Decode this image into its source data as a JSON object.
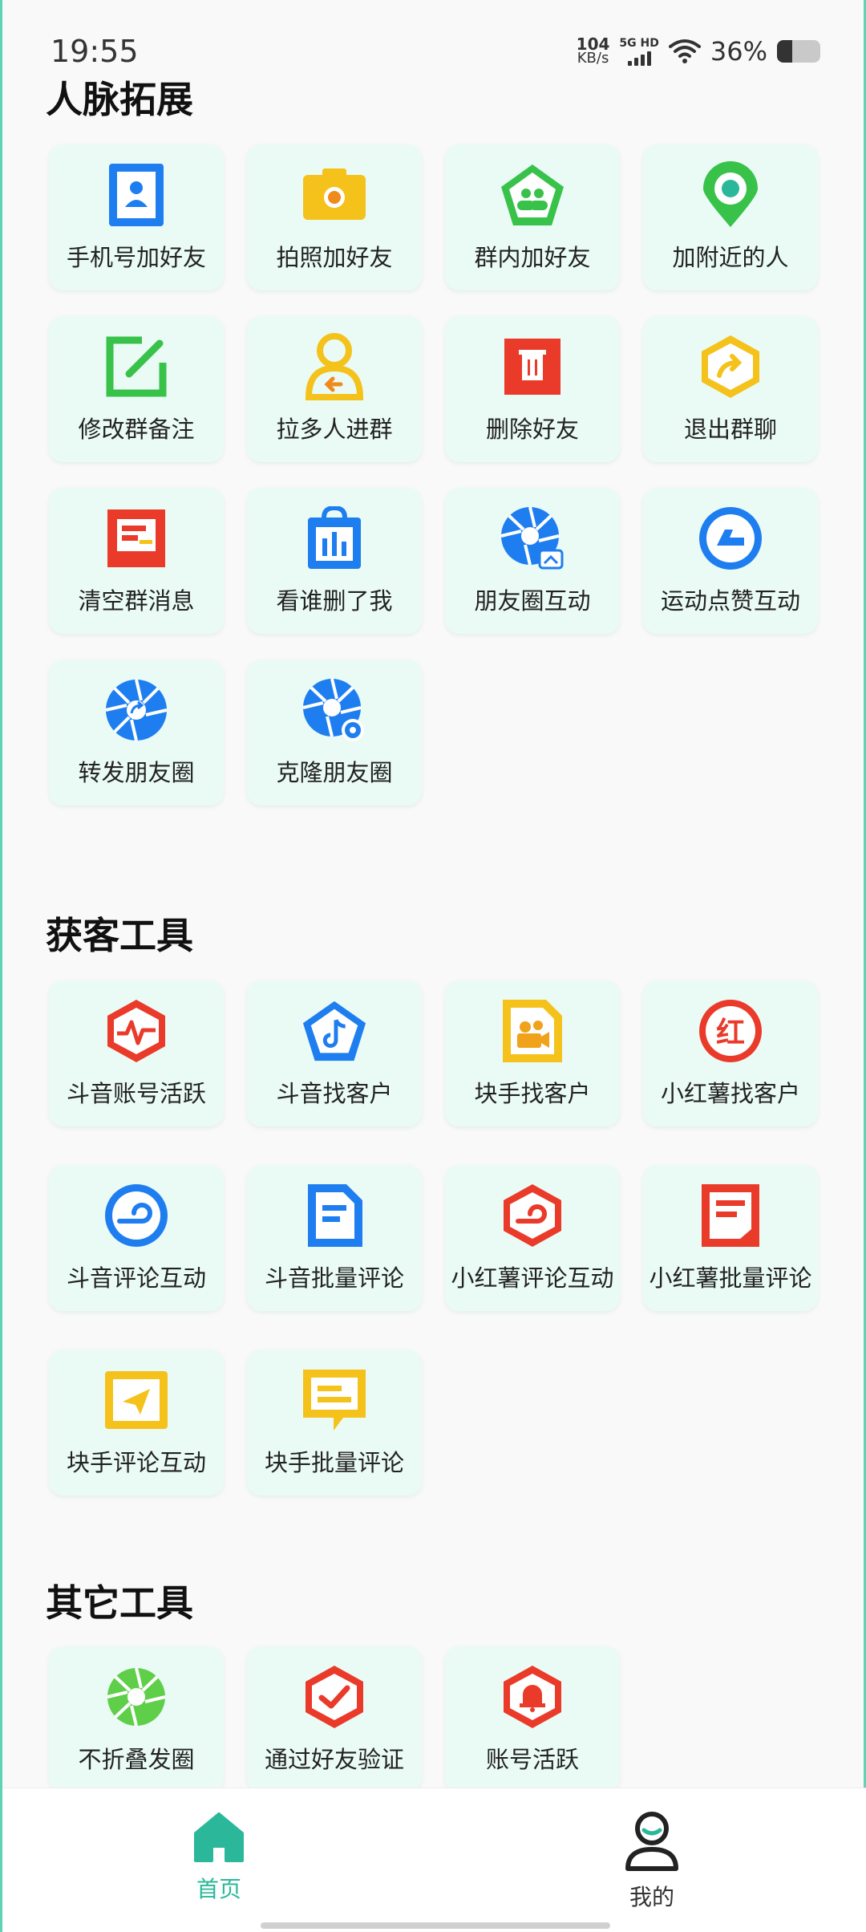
{
  "status": {
    "time": "19:55",
    "net_speed_value": "104",
    "net_speed_unit": "KB/s",
    "signal_label": "5G HD",
    "battery_percent": "36%",
    "battery_level": 0.36
  },
  "sections": [
    {
      "title": "人脉拓展",
      "items": [
        {
          "label": "手机号加好友",
          "icon": "phone-contact-icon"
        },
        {
          "label": "拍照加好友",
          "icon": "camera-icon"
        },
        {
          "label": "群内加好友",
          "icon": "group-users-icon"
        },
        {
          "label": "加附近的人",
          "icon": "location-pin-icon"
        },
        {
          "label": "修改群备注",
          "icon": "edit-icon"
        },
        {
          "label": "拉多人进群",
          "icon": "user-invite-icon"
        },
        {
          "label": "删除好友",
          "icon": "trash-icon"
        },
        {
          "label": "退出群聊",
          "icon": "exit-share-icon"
        },
        {
          "label": "清空群消息",
          "icon": "clear-message-icon"
        },
        {
          "label": "看谁删了我",
          "icon": "bag-chart-icon"
        },
        {
          "label": "朋友圈互动",
          "icon": "moments-interact-icon"
        },
        {
          "label": "运动点赞互动",
          "icon": "sport-like-icon"
        },
        {
          "label": "转发朋友圈",
          "icon": "moments-forward-icon"
        },
        {
          "label": "克隆朋友圈",
          "icon": "moments-clone-icon"
        }
      ]
    },
    {
      "title": "获客工具",
      "items": [
        {
          "label": "斗音账号活跃",
          "icon": "pulse-hexagon-icon"
        },
        {
          "label": "斗音找客户",
          "icon": "music-note-icon"
        },
        {
          "label": "块手找客户",
          "icon": "video-camera-icon"
        },
        {
          "label": "小红薯找客户",
          "icon": "red-badge-icon"
        },
        {
          "label": "斗音评论互动",
          "icon": "comment-circle-icon"
        },
        {
          "label": "斗音批量评论",
          "icon": "document-icon"
        },
        {
          "label": "小红薯评论互动",
          "icon": "comment-hexagon-icon"
        },
        {
          "label": "小红薯批量评论",
          "icon": "document-red-icon"
        },
        {
          "label": "块手评论互动",
          "icon": "send-icon"
        },
        {
          "label": "块手批量评论",
          "icon": "message-list-icon"
        }
      ]
    },
    {
      "title": "其它工具",
      "items": [
        {
          "label": "不折叠发圈",
          "icon": "aperture-green-icon"
        },
        {
          "label": "通过好友验证",
          "icon": "verify-check-icon"
        },
        {
          "label": "账号活跃",
          "icon": "bell-hexagon-icon"
        }
      ]
    }
  ],
  "nav": {
    "home_label": "首页",
    "profile_label": "我的",
    "active_color": "#2bb89a"
  },
  "colors": {
    "tile_bg": "#eafbf6",
    "blue": "#1e7ef0",
    "yellow": "#f4c21b",
    "green": "#38c24a",
    "red": "#ea3a2a"
  }
}
